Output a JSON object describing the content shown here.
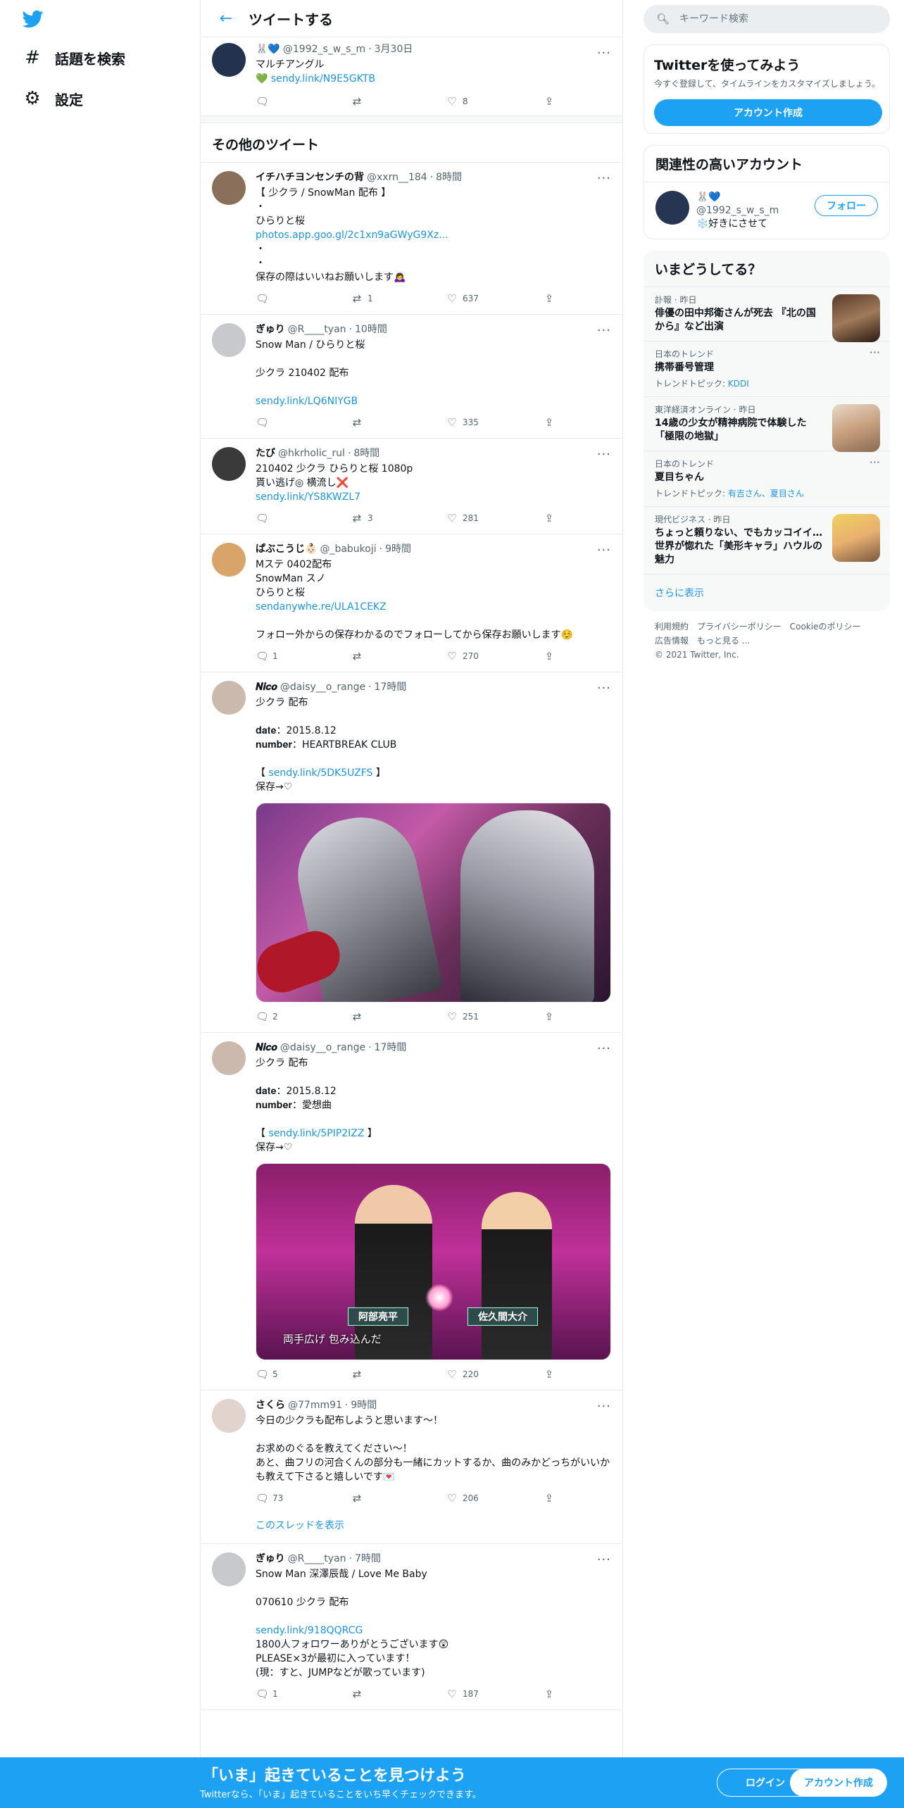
{
  "nav": {
    "explore_label": "話題を検索",
    "settings_label": "設定"
  },
  "header": {
    "title": "ツイートする"
  },
  "main_tweet": {
    "name": "🐰💙",
    "handle": "@1992_s_w_s_m",
    "time": "3月30日",
    "text": "マルチアングル",
    "link_prefix": "💚 ",
    "link": "sendy.link/N9E5GKTB",
    "likes": "8"
  },
  "section_title": "その他のツイート",
  "tweets": [
    {
      "name": "イチハチヨンセンチの背",
      "handle": "@xxrn__184",
      "time": "8時間",
      "lines": [
        "【 少クラ / SnowMan 配布 】",
        "・",
        "ひらりと桜"
      ],
      "link": "photos.app.goo.gl/2c1xn9aGWyG9Xz...",
      "after": [
        "・",
        "・",
        "保存の際はいいねお願いします🙇‍♀️"
      ],
      "replies": "",
      "retweets": "1",
      "likes": "637"
    },
    {
      "name": "ぎゅり",
      "handle": "@R____tyan",
      "time": "10時間",
      "lines": [
        "Snow Man / ひらりと桜",
        "",
        "少クラ 210402 配布",
        ""
      ],
      "link": "sendy.link/LQ6NIYGB",
      "after": [],
      "replies": "",
      "retweets": "",
      "likes": "335"
    },
    {
      "name": "たび",
      "handle": "@hkrholic_rul",
      "time": "8時間",
      "lines": [
        "210402 少クラ ひらりと桜 1080p",
        "貰い逃げ◎ 横流し❌"
      ],
      "link": "sendy.link/YS8KWZL7",
      "after": [],
      "replies": "",
      "retweets": "3",
      "likes": "281"
    },
    {
      "name": "ぱぶこうじ👶🏻",
      "handle": "@_babukoji",
      "time": "9時間",
      "lines": [
        "Mステ 0402配布",
        "SnowMan スノ",
        "ひらりと桜"
      ],
      "link": "sendanywhe.re/ULA1CEKZ",
      "after": [
        "",
        "フォロー外からの保存わかるのでフォローしてから保存お願いします☺️"
      ],
      "replies": "1",
      "retweets": "",
      "likes": "270"
    },
    {
      "name": "𝑵𝒊𝒄𝒐",
      "handle": "@daisy__o_range",
      "time": "17時間",
      "lines": [
        "少クラ 配布",
        "",
        "𝐝𝐚𝐭𝐞：2015.8.12",
        "𝐧𝐮𝐦𝐛𝐞𝐫：HEARTBREAK CLUB",
        ""
      ],
      "link_wrap": [
        "【 ",
        " 】"
      ],
      "link": "sendy.link/5DK5UZFS",
      "after": [
        "保存→♡"
      ],
      "media": "stage-guitar",
      "replies": "2",
      "retweets": "",
      "likes": "251"
    },
    {
      "name": "𝑵𝒊𝒄𝒐",
      "handle": "@daisy__o_range",
      "time": "17時間",
      "lines": [
        "少クラ 配布",
        "",
        "𝐝𝐚𝐭𝐞：2015.8.12",
        "𝐧𝐮𝐦𝐛𝐞𝐫：愛想曲",
        ""
      ],
      "link_wrap": [
        "【 ",
        " 】"
      ],
      "link": "sendy.link/5PIP2IZZ",
      "after": [
        "保存→♡"
      ],
      "media": "stage-duet",
      "caption": "両手広げ  包み込んだ",
      "tag1": "阿部亮平",
      "tag2": "佐久間大介",
      "replies": "5",
      "retweets": "",
      "likes": "220"
    },
    {
      "name": "さくら",
      "handle": "@77mm91",
      "time": "9時間",
      "lines": [
        "今日の少クラも配布しようと思います〜！",
        "",
        "お求めのぐるを教えてください〜！",
        "あと、曲フリの河合くんの部分も一緒にカットするか、曲のみかどっちがいいかも教えて下さると嬉しいです💌"
      ],
      "link": "",
      "after": [],
      "replies": "73",
      "retweets": "",
      "likes": "206",
      "thread": "このスレッドを表示"
    },
    {
      "name": "ぎゅり",
      "handle": "@R____tyan",
      "time": "7時間",
      "lines": [
        "Snow Man 深澤辰哉 / Love Me Baby",
        "",
        "070610 少クラ 配布",
        ""
      ],
      "link": "sendy.link/918QQRCG",
      "after": [
        "1800人フォロワーありがとうございます😲",
        "PLEASE×3が最初に入っています！",
        "(現：すと、JUMPなどが歌っています)"
      ],
      "replies": "1",
      "retweets": "",
      "likes": "187"
    }
  ],
  "right": {
    "search_placeholder": "キーワード検索",
    "signup_card": {
      "title": "Twitterを使ってみよう",
      "subtitle": "今すぐ登録して、タイムラインをカスタマイズしましょう。",
      "button": "アカウント作成"
    },
    "related": {
      "title": "関連性の高いアカウント",
      "name": "🐰💙",
      "handle": "@1992_s_w_s_m",
      "bio": "❄️好きにさせて",
      "follow": "フォロー"
    },
    "trends": {
      "title": "いまどうしてる？",
      "items": [
        {
          "meta": "訃報 · 昨日",
          "title": "俳優の田中邦衛さんが死去 『北の国から』など出演",
          "sub_label": "",
          "sub_links": "",
          "thumb": true
        },
        {
          "meta": "日本のトレンド",
          "title": "携帯番号管理",
          "sub_label": "トレンドトピック: ",
          "sub_links": "KDDI",
          "thumb": false
        },
        {
          "meta": "東洋経済オンライン · 昨日",
          "title": "14歳の少女が精神病院で体験した「極限の地獄」",
          "sub_label": "",
          "sub_links": "",
          "thumb": true
        },
        {
          "meta": "日本のトレンド",
          "title": "夏目ちゃん",
          "sub_label": "トレンドトピック: ",
          "sub_links": "有吉さん、夏目さん",
          "thumb": false
        },
        {
          "meta": "現代ビジネス · 昨日",
          "title": "ちょっと頼りない、でもカッコイイ…世界が惚れた「美形キャラ」ハウルの魅力",
          "sub_label": "",
          "sub_links": "",
          "thumb": true
        }
      ],
      "show_more": "さらに表示"
    },
    "footer": {
      "links": [
        "利用規約",
        "プライバシーポリシー",
        "Cookieのポリシー",
        "広告情報",
        "もっと見る ..."
      ],
      "copyright": "© 2021 Twitter, Inc."
    }
  },
  "banner": {
    "title": "「いま」起きていることを見つけよう",
    "subtitle": "Twitterなら、「いま」起きていることをいち早くチェックできます。",
    "login": "ログイン",
    "signup": "アカウント作成"
  },
  "colors": {
    "accent": "#1da1f2",
    "link": "#1b95e0",
    "border": "#e6ecf0"
  },
  "icons": [
    "twitter-bird-icon",
    "hashtag-icon",
    "gear-icon",
    "back-arrow-icon",
    "search-icon",
    "reply-icon",
    "retweet-icon",
    "heart-icon",
    "share-icon",
    "more-icon",
    "verified-icon"
  ]
}
